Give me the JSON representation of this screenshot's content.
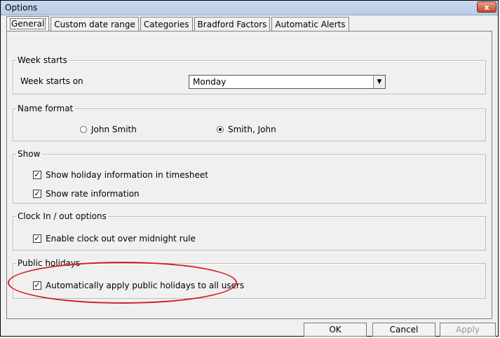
{
  "window": {
    "title": "Options",
    "close_label": "x"
  },
  "tabs": [
    {
      "label": "General"
    },
    {
      "label": "Custom date range"
    },
    {
      "label": "Categories"
    },
    {
      "label": "Bradford Factors"
    },
    {
      "label": "Automatic Alerts"
    }
  ],
  "week_starts": {
    "legend": "Week starts",
    "label": "Week starts on",
    "value": "Monday"
  },
  "name_format": {
    "legend": "Name format",
    "options": [
      {
        "label": "John Smith",
        "selected": false
      },
      {
        "label": "Smith, John",
        "selected": true
      }
    ]
  },
  "show": {
    "legend": "Show",
    "items": [
      {
        "label": "Show holiday information in timesheet",
        "checked": true
      },
      {
        "label": "Show rate information",
        "checked": true
      }
    ]
  },
  "clock": {
    "legend": "Clock In / out options",
    "items": [
      {
        "label": "Enable clock out over midnight rule",
        "checked": true
      }
    ]
  },
  "public_holidays": {
    "legend": "Public holidays",
    "items": [
      {
        "label": "Automatically apply public holidays to all users",
        "checked": true
      }
    ]
  },
  "buttons": {
    "ok": "OK",
    "cancel": "Cancel",
    "apply": "Apply"
  },
  "colors": {
    "highlight": "#d21e1e"
  }
}
